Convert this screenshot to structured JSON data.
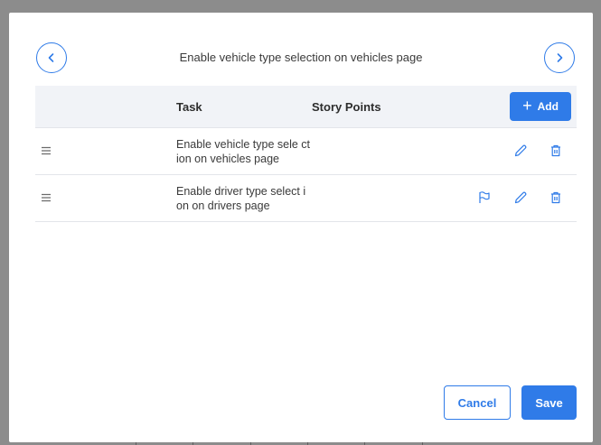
{
  "dialog": {
    "title": "Enable vehicle type selection on vehicles page"
  },
  "table": {
    "headers": {
      "task": "Task",
      "story_points": "Story Points"
    },
    "add_label": "Add",
    "rows": [
      {
        "task": "Enable vehicle type sele ction on vehicles page",
        "story_points": "",
        "flagged": false
      },
      {
        "task": "Enable driver type select ion on drivers page",
        "story_points": "",
        "flagged": true
      }
    ]
  },
  "footer": {
    "cancel_label": "Cancel",
    "save_label": "Save"
  },
  "icons": {
    "prev": "chevron-left-icon",
    "next": "chevron-right-icon",
    "drag": "drag-handle-icon",
    "flag": "flag-icon",
    "edit": "pencil-icon",
    "delete": "trash-icon",
    "add": "plus-icon"
  },
  "colors": {
    "accent": "#2f7be8",
    "header_bg": "#f1f3f7",
    "backdrop": "#8c8c8c"
  }
}
